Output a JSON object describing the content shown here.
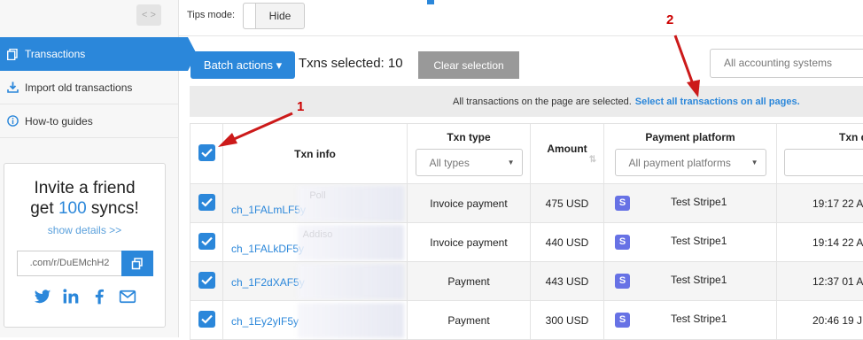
{
  "sidebar": {
    "collapse_label": "< >",
    "items": [
      {
        "label": "Transactions",
        "icon": "copy-icon",
        "active": true
      },
      {
        "label": "Import old transactions",
        "icon": "download-icon"
      },
      {
        "label": "How-to guides",
        "icon": "info-icon"
      }
    ],
    "invite": {
      "line1": "Invite a friend",
      "line2_prefix": "get ",
      "line2_number": "100",
      "line2_suffix": " syncs!",
      "details_link": "show details >>",
      "ref_value": ".com/r/DuEMchH2",
      "social_icons": [
        "twitter-icon",
        "linkedin-icon",
        "facebook-icon",
        "mail-icon"
      ]
    }
  },
  "topbar": {
    "tips_label": "Tips mode:",
    "tips_value": "Hide"
  },
  "actions": {
    "batch_label": "Batch actions ▾",
    "selected_text": "Txns selected: 10",
    "clear_label": "Clear selection",
    "accounting_placeholder": "All accounting systems"
  },
  "banner": {
    "text": "All transactions on the page are selected.",
    "link": "Select all transactions on all pages."
  },
  "table": {
    "headers": {
      "txn_info": "Txn info",
      "txn_type": "Txn type",
      "txn_type_filter": "All types",
      "amount": "Amount",
      "platform": "Payment platform",
      "platform_filter": "All payment platforms",
      "date": "Txn d"
    },
    "rows": [
      {
        "name": "Poll",
        "id": "ch_1FALmLF5y",
        "type": "Invoice payment",
        "amount": "475 USD",
        "platform": "Test Stripe1",
        "date": "19:17 22 A"
      },
      {
        "name": "Addiso",
        "id": "ch_1FALkDF5y",
        "type": "Invoice payment",
        "amount": "440 USD",
        "platform": "Test Stripe1",
        "date": "19:14 22 A"
      },
      {
        "name": "",
        "id": "ch_1F2dXAF5y",
        "type": "Payment",
        "amount": "443 USD",
        "platform": "Test Stripe1",
        "date": "12:37 01 A"
      },
      {
        "name": "",
        "id": "ch_1Ey2yIF5y",
        "type": "Payment",
        "amount": "300 USD",
        "platform": "Test Stripe1",
        "date": "20:46 19 J"
      }
    ]
  },
  "annotations": {
    "one": "1",
    "two": "2"
  },
  "colors": {
    "accent": "#2b87da",
    "annotation": "#cc0000",
    "stripe": "#6772e5"
  }
}
